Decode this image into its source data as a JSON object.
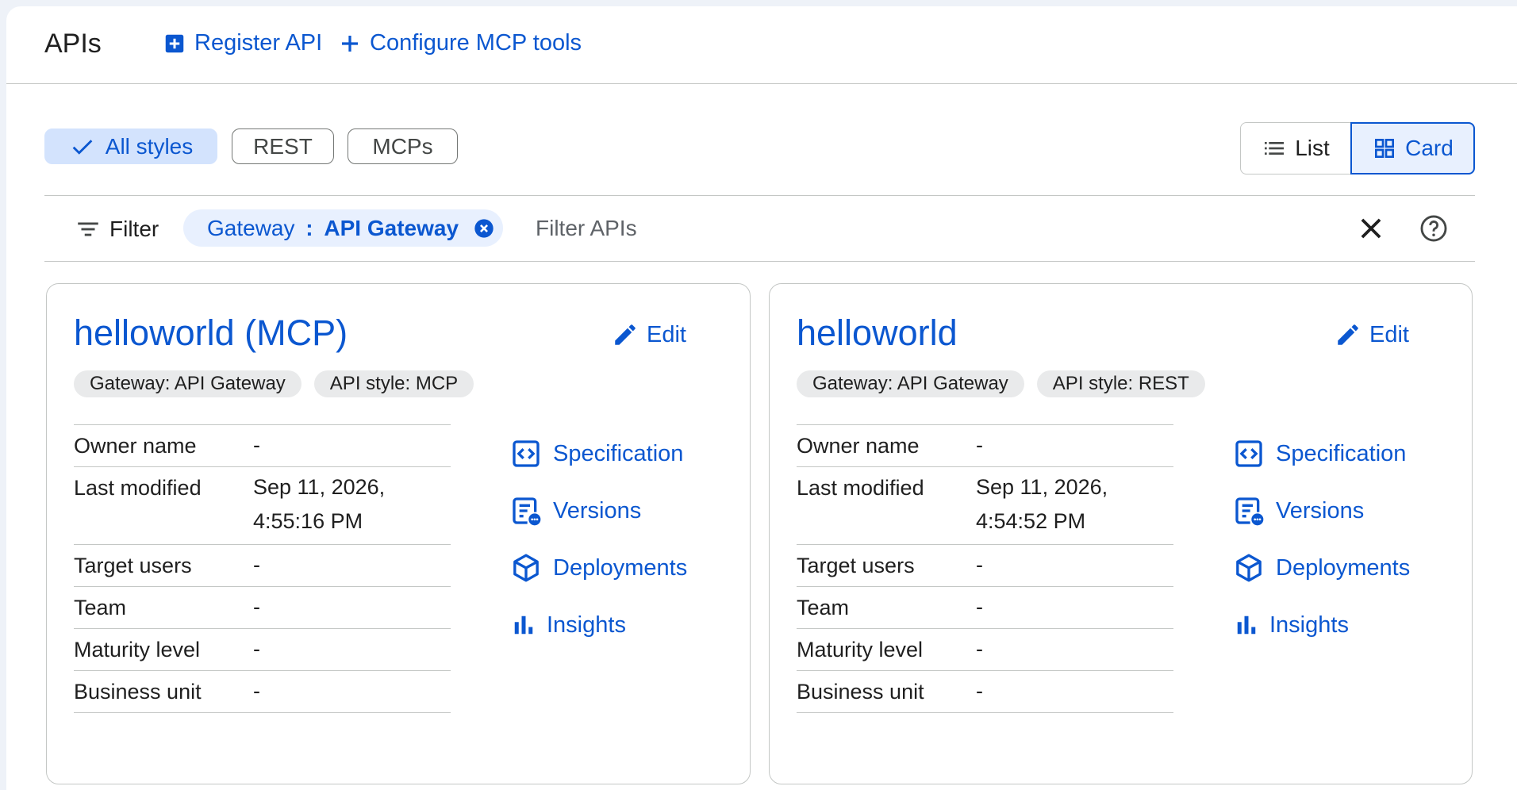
{
  "header": {
    "title": "APIs",
    "register_label": "Register API",
    "configure_label": "Configure MCP tools"
  },
  "style_filters": [
    "All styles",
    "REST",
    "MCPs"
  ],
  "view_toggle": {
    "list_label": "List",
    "card_label": "Card",
    "selected": "Card"
  },
  "filter_bar": {
    "label": "Filter",
    "chip_key": "Gateway",
    "chip_sep": " : ",
    "chip_value": "API Gateway",
    "placeholder": "Filter APIs"
  },
  "cards": [
    {
      "title": "helloworld (MCP)",
      "edit_label": "Edit",
      "tags": [
        "Gateway: API Gateway",
        "API style: MCP"
      ],
      "details": [
        {
          "label": "Owner name",
          "value": "-"
        },
        {
          "label": "Last modified",
          "value": "Sep 11, 2026,\n4:55:16 PM"
        },
        {
          "label": "Target users",
          "value": "-"
        },
        {
          "label": "Team",
          "value": "-"
        },
        {
          "label": "Maturity level",
          "value": "-"
        },
        {
          "label": "Business unit",
          "value": "-"
        }
      ],
      "links": [
        "Specification",
        "Versions",
        "Deployments",
        "Insights"
      ]
    },
    {
      "title": "helloworld",
      "edit_label": "Edit",
      "tags": [
        "Gateway: API Gateway",
        "API style: REST"
      ],
      "details": [
        {
          "label": "Owner name",
          "value": "-"
        },
        {
          "label": "Last modified",
          "value": "Sep 11, 2026,\n4:54:52 PM"
        },
        {
          "label": "Target users",
          "value": "-"
        },
        {
          "label": "Team",
          "value": "-"
        },
        {
          "label": "Maturity level",
          "value": "-"
        },
        {
          "label": "Business unit",
          "value": "-"
        }
      ],
      "links": [
        "Specification",
        "Versions",
        "Deployments",
        "Insights"
      ]
    }
  ],
  "icons": {
    "register": "add-box-icon",
    "configure": "plus-icon",
    "check": "check-icon",
    "list": "list-icon",
    "card": "grid-icon",
    "filter": "filter-icon",
    "remove_chip": "cancel-circle-icon",
    "clear": "close-icon",
    "help": "help-icon",
    "edit": "pencil-icon",
    "specification": "code-icon",
    "versions": "versions-icon",
    "deployments": "cube-icon",
    "insights": "bar-chart-icon"
  },
  "colors": {
    "accent": "#0b57d0",
    "selected_chip_bg": "#d3e3fd",
    "tag_bg": "#e9eaeb"
  }
}
